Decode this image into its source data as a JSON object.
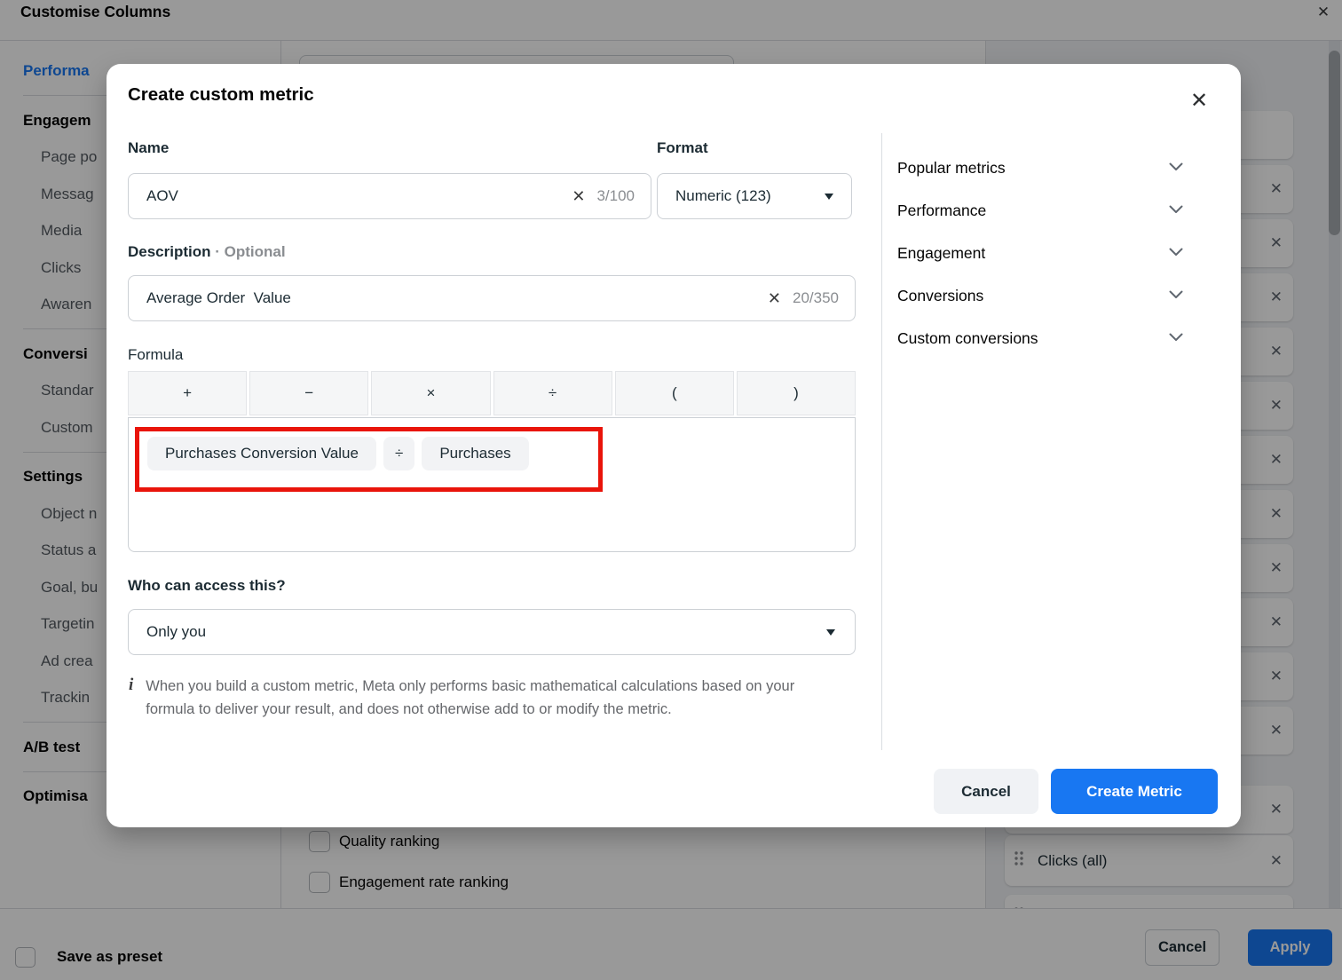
{
  "dialog": {
    "title": "Customise Columns",
    "sidebar": {
      "sections": [
        {
          "header": "Performa",
          "active": true,
          "items": []
        },
        {
          "header": "Engagem",
          "active": false,
          "items": [
            "Page po",
            "Messag",
            "Media",
            "Clicks",
            "Awaren"
          ]
        },
        {
          "header": "Conversi",
          "active": false,
          "items": [
            "Standar",
            "Custom"
          ]
        },
        {
          "header": "Settings",
          "active": false,
          "items": [
            "Object n",
            "Status a",
            "Goal, bu",
            "Targetin",
            "Ad crea",
            "Trackin"
          ]
        },
        {
          "header": "A/B test",
          "active": false,
          "items": []
        },
        {
          "header": "Optimisa",
          "active": false,
          "items": []
        }
      ]
    },
    "main": {
      "checkbox_labels": [
        "Quality ranking",
        "Engagement rate ranking"
      ]
    },
    "columns_panel": {
      "hidden_card_count": 13,
      "visible_card_label": "Clicks (all)"
    },
    "footer": {
      "save_as_preset": "Save as preset",
      "cancel": "Cancel",
      "apply": "Apply"
    }
  },
  "modal": {
    "title": "Create custom metric",
    "name": {
      "label": "Name",
      "value": "AOV",
      "counter": "3/100"
    },
    "format": {
      "label": "Format",
      "value": "Numeric (123)"
    },
    "description": {
      "label": "Description",
      "optional": " · Optional",
      "value": "Average Order  Value",
      "counter": "20/350"
    },
    "formula": {
      "label": "Formula",
      "operators": [
        "+",
        "−",
        "×",
        "÷",
        "(",
        ")"
      ],
      "tokens": [
        "Purchases Conversion Value",
        "÷",
        "Purchases"
      ]
    },
    "access": {
      "label": "Who can access this?",
      "value": "Only you"
    },
    "info_icon": "i",
    "info_text": "When you build a custom metric, Meta only performs basic mathematical calculations based on your formula to deliver your result, and does not otherwise add to or modify the metric.",
    "categories": [
      "Popular metrics",
      "Performance",
      "Engagement",
      "Conversions",
      "Custom conversions"
    ],
    "buttons": {
      "cancel": "Cancel",
      "create": "Create Metric"
    }
  },
  "icons": {
    "close": "✕"
  },
  "colors": {
    "accent_blue": "#1877f2",
    "annotation_red": "#e9140a",
    "overlay": "rgba(0,0,0,0.40)"
  }
}
